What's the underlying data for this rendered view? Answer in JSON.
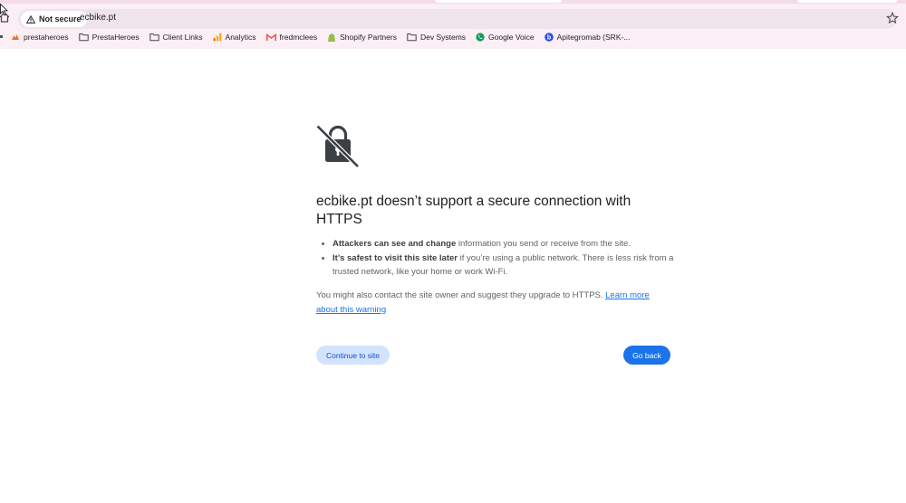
{
  "browser": {
    "security_chip": "Not secure",
    "url": "ecbike.pt"
  },
  "bookmarks": [
    {
      "label": "prestaheroes",
      "icon": "prestaheroes-icon"
    },
    {
      "label": "PrestaHeroes",
      "icon": "folder-icon"
    },
    {
      "label": "Client Links",
      "icon": "folder-icon"
    },
    {
      "label": "Analytics",
      "icon": "analytics-icon"
    },
    {
      "label": "fredmclees",
      "icon": "gmail-icon"
    },
    {
      "label": "Shopify Partners",
      "icon": "shopify-icon"
    },
    {
      "label": "Dev Systems",
      "icon": "folder-icon"
    },
    {
      "label": "Google Voice",
      "icon": "phone-icon"
    },
    {
      "label": "Apitegromab (SRK-...",
      "icon": "b-icon"
    }
  ],
  "interstitial": {
    "heading": "ecbike.pt doesn’t support a secure connection with HTTPS",
    "bullet1_bold": "Attackers can see and change",
    "bullet1_rest": " information you send or receive from the site.",
    "bullet2_bold": "It’s safest to visit this site later",
    "bullet2_rest": " if you’re using a public network. There is less risk from a trusted network, like your home or work Wi-Fi.",
    "note_text": "You might also contact the site owner and suggest they upgrade to HTTPS. ",
    "learn_more": "Learn more about this warning",
    "continue_label": "Continue to site",
    "back_label": "Go back"
  },
  "colors": {
    "chrome_bg": "#fbeef5",
    "primary_button": "#1a73e8",
    "secondary_button": "#d3e3fd",
    "link": "#1a73e8"
  }
}
